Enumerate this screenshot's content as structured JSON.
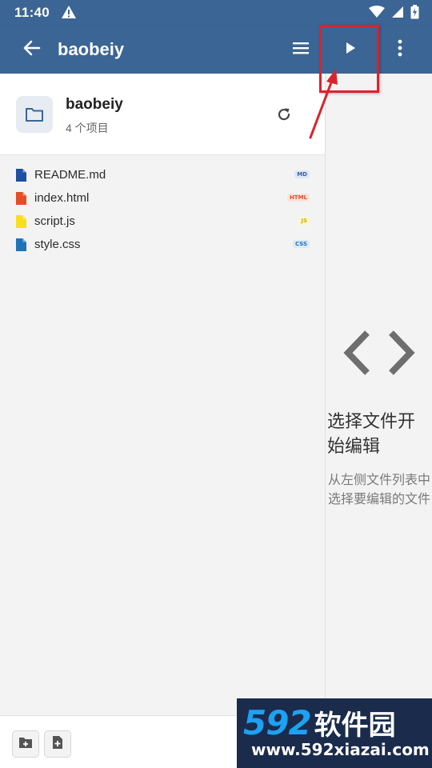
{
  "status_bar": {
    "time": "11:40",
    "icons": [
      "warning-icon",
      "wifi-icon",
      "signal-icon",
      "battery-icon"
    ]
  },
  "app_bar": {
    "title": "baobeiy",
    "icons": [
      "back-arrow-icon",
      "hamburger-menu-icon",
      "play-icon",
      "more-vert-icon"
    ],
    "color": "#3b6594"
  },
  "folder": {
    "name": "baobeiy",
    "count": "4 个项目"
  },
  "files": [
    {
      "name": "README.md",
      "badge": "MD",
      "icon_color": "#1e4fa3",
      "badge_color": "#3b5fa8",
      "badge_bg": "#dfe7f5"
    },
    {
      "name": "index.html",
      "badge": "HTML",
      "icon_color": "#e44d26",
      "badge_color": "#e44d26",
      "badge_bg": "#fbe3dc"
    },
    {
      "name": "script.js",
      "badge": "JS",
      "icon_color": "#f7df1e",
      "badge_color": "#c9b400",
      "badge_bg": "#fdf7cf"
    },
    {
      "name": "style.css",
      "badge": "CSS",
      "icon_color": "#1f74b8",
      "badge_color": "#1f74b8",
      "badge_bg": "#dce9f5"
    }
  ],
  "bottom_bar": {
    "buttons": [
      "new-folder-icon",
      "new-file-icon"
    ]
  },
  "editor_empty": {
    "title": "选择文件开始编辑",
    "description": "从左侧文件列表中选择要编辑的文件"
  },
  "annotation": {
    "highlight_color": "#d9242b"
  },
  "watermark": {
    "number": "592",
    "brand": "软件园",
    "url": "www.592xiazai.com"
  }
}
